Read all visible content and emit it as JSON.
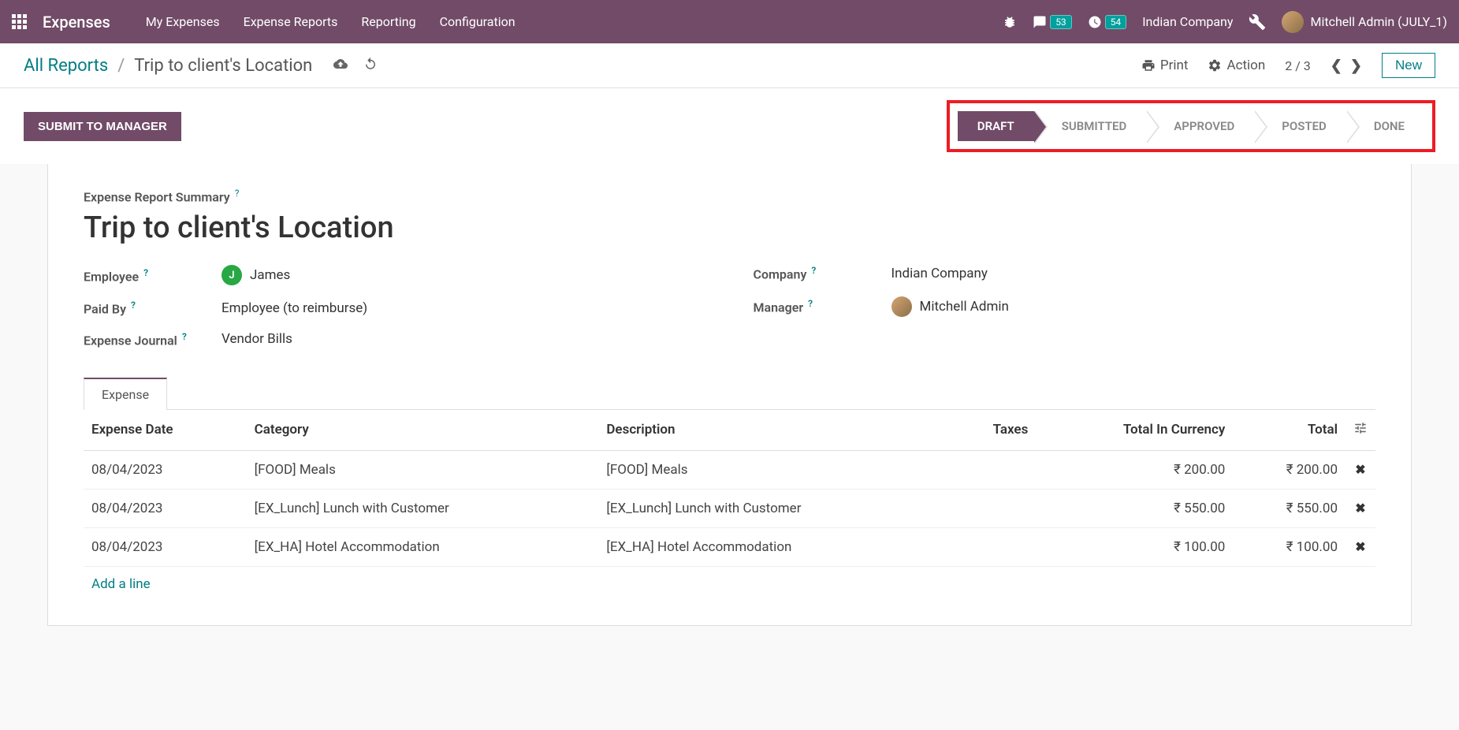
{
  "navbar": {
    "brand": "Expenses",
    "menu": [
      "My Expenses",
      "Expense Reports",
      "Reporting",
      "Configuration"
    ],
    "messages_badge": "53",
    "activities_badge": "54",
    "company": "Indian Company",
    "user_name": "Mitchell Admin (JULY_1)"
  },
  "breadcrumb": {
    "parent": "All Reports",
    "current": "Trip to client's Location",
    "print_label": "Print",
    "action_label": "Action",
    "pager": "2 / 3",
    "new_label": "New"
  },
  "status_row": {
    "submit_label": "SUBMIT TO MANAGER",
    "steps": [
      "DRAFT",
      "SUBMITTED",
      "APPROVED",
      "POSTED",
      "DONE"
    ],
    "active_index": 0
  },
  "form": {
    "summary_label": "Expense Report Summary",
    "title": "Trip to client's  Location",
    "fields": {
      "employee_label": "Employee",
      "employee_value": "James",
      "employee_initial": "J",
      "paid_by_label": "Paid By",
      "paid_by_value": "Employee (to reimburse)",
      "journal_label": "Expense Journal",
      "journal_value": "Vendor Bills",
      "company_label": "Company",
      "company_value": "Indian Company",
      "manager_label": "Manager",
      "manager_value": "Mitchell Admin"
    }
  },
  "tabs": {
    "expense": "Expense"
  },
  "table": {
    "headers": {
      "date": "Expense Date",
      "category": "Category",
      "description": "Description",
      "taxes": "Taxes",
      "total_currency": "Total In Currency",
      "total": "Total"
    },
    "rows": [
      {
        "date": "08/04/2023",
        "category": "[FOOD] Meals",
        "description": "[FOOD] Meals",
        "taxes": "",
        "total_currency": "₹ 200.00",
        "total": "₹ 200.00"
      },
      {
        "date": "08/04/2023",
        "category": "[EX_Lunch] Lunch with Customer",
        "description": "[EX_Lunch] Lunch with Customer",
        "taxes": "",
        "total_currency": "₹ 550.00",
        "total": "₹ 550.00"
      },
      {
        "date": "08/04/2023",
        "category": "[EX_HA] Hotel Accommodation",
        "description": "[EX_HA] Hotel Accommodation",
        "taxes": "",
        "total_currency": "₹ 100.00",
        "total": "₹ 100.00"
      }
    ],
    "add_line": "Add a line"
  }
}
